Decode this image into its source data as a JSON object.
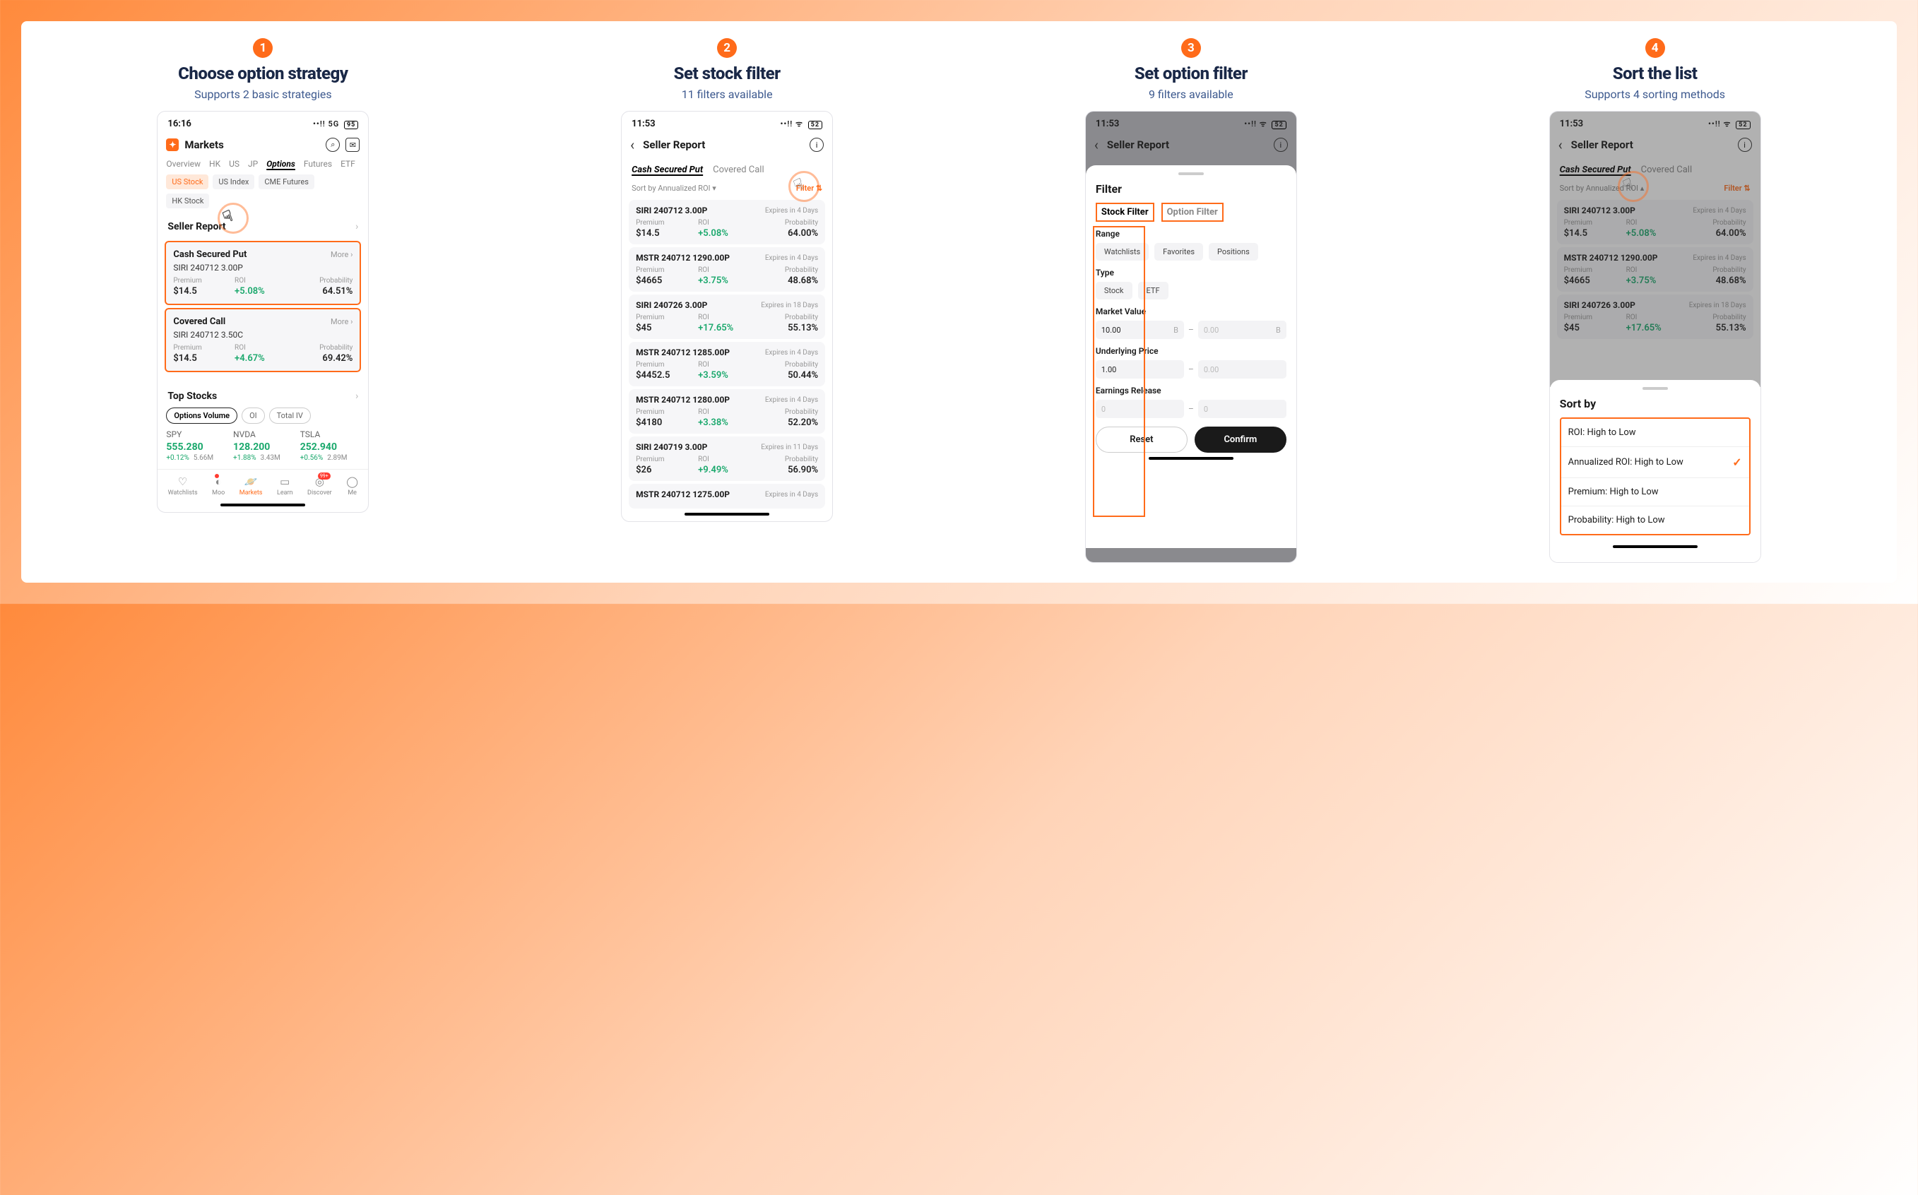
{
  "steps": [
    {
      "num": "1",
      "title": "Choose option strategy",
      "subtitle": "Supports 2 basic strategies"
    },
    {
      "num": "2",
      "title": "Set stock filter",
      "subtitle": "11 filters available"
    },
    {
      "num": "3",
      "title": "Set option filter",
      "subtitle": "9 filters available"
    },
    {
      "num": "4",
      "title": "Sort  the list",
      "subtitle": "Supports 4 sorting methods"
    }
  ],
  "p1": {
    "time": "16:16",
    "signal": "5G",
    "battery": "95",
    "brand": "Markets",
    "nav": [
      "Overview",
      "HK",
      "US",
      "JP",
      "Options",
      "Futures",
      "ETF"
    ],
    "navActive": "Options",
    "chips": [
      "US Stock",
      "US Index",
      "CME Futures",
      "HK Stock"
    ],
    "chipActive": "US Stock",
    "section": "Seller Report",
    "cards": [
      {
        "title": "Cash Secured Put",
        "more": "More ›",
        "sub": "SIRI 240712 3.00P",
        "premium": "$14.5",
        "roi": "+5.08%",
        "prob": "64.51%"
      },
      {
        "title": "Covered Call",
        "more": "More ›",
        "sub": "SIRI 240712 3.50C",
        "premium": "$14.5",
        "roi": "+4.67%",
        "prob": "69.42%"
      }
    ],
    "topStocks": "Top Stocks",
    "pills": [
      "Options Volume",
      "OI",
      "Total IV"
    ],
    "stocks": [
      {
        "sym": "SPY",
        "pr": "555.280",
        "pct": "+0.12%",
        "vol": "5.66M"
      },
      {
        "sym": "NVDA",
        "pr": "128.200",
        "pct": "+1.88%",
        "vol": "3.43M"
      },
      {
        "sym": "TSLA",
        "pr": "252.940",
        "pct": "+0.56%",
        "vol": "2.89M"
      }
    ],
    "bottomNav": [
      "Watchlists",
      "Moo",
      "Markets",
      "Learn",
      "Discover",
      "Me"
    ],
    "lbl": {
      "premium": "Premium",
      "roi": "ROI",
      "prob": "Probability"
    }
  },
  "p2": {
    "time": "11:53",
    "battery": "52",
    "header": "Seller Report",
    "stratTabs": [
      "Cash Secured Put",
      "Covered Call"
    ],
    "sortLabel": "Sort by Annualized ROI ▾",
    "filterLabel": "Filter ⇅",
    "items": [
      {
        "t": "SIRI 240712 3.00P",
        "exp": "Expires in 4 Days",
        "premium": "$14.5",
        "roi": "+5.08%",
        "prob": "64.00%"
      },
      {
        "t": "MSTR 240712 1290.00P",
        "exp": "Expires in 4 Days",
        "premium": "$4665",
        "roi": "+3.75%",
        "prob": "48.68%"
      },
      {
        "t": "SIRI 240726 3.00P",
        "exp": "Expires in 18 Days",
        "premium": "$45",
        "roi": "+17.65%",
        "prob": "55.13%"
      },
      {
        "t": "MSTR 240712 1285.00P",
        "exp": "Expires in 4 Days",
        "premium": "$4452.5",
        "roi": "+3.59%",
        "prob": "50.44%"
      },
      {
        "t": "MSTR 240712 1280.00P",
        "exp": "Expires in 4 Days",
        "premium": "$4180",
        "roi": "+3.38%",
        "prob": "52.20%"
      },
      {
        "t": "SIRI 240719 3.00P",
        "exp": "Expires in 11 Days",
        "premium": "$26",
        "roi": "+9.49%",
        "prob": "56.90%"
      },
      {
        "t": "MSTR 240712 1275.00P",
        "exp": "Expires in 4 Days"
      }
    ]
  },
  "p3": {
    "time": "11:53",
    "battery": "52",
    "header": "Seller Report",
    "filterTitle": "Filter",
    "filterTabs": [
      "Stock Filter",
      "Option Filter"
    ],
    "sections": {
      "range": {
        "label": "Range",
        "chips": [
          "Watchlists",
          "Favorites",
          "Positions"
        ]
      },
      "type": {
        "label": "Type",
        "chips": [
          "Stock",
          "ETF"
        ]
      },
      "mv": {
        "label": "Market Value",
        "from": "10.00",
        "unit": "B",
        "to": "0.00"
      },
      "up": {
        "label": "Underlying Price",
        "from": "1.00",
        "to": "0.00"
      },
      "er": {
        "label": "Earnings Release",
        "from": "0",
        "to": "0"
      }
    },
    "reset": "Reset",
    "confirm": "Confirm"
  },
  "p4": {
    "time": "11:53",
    "battery": "52",
    "header": "Seller Report",
    "stratTabs": [
      "Cash Secured Put",
      "Covered Call"
    ],
    "sortLabel": "Sort by Annualized ROI ▴",
    "filterLabel": "Filter ⇅",
    "items": [
      {
        "t": "SIRI 240712 3.00P",
        "exp": "Expires in 4 Days",
        "premium": "$14.5",
        "roi": "+5.08%",
        "prob": "64.00%"
      },
      {
        "t": "MSTR 240712 1290.00P",
        "exp": "Expires in 4 Days",
        "premium": "$4665",
        "roi": "+3.75%",
        "prob": "48.68%"
      },
      {
        "t": "SIRI 240726 3.00P",
        "exp": "Expires in 18 Days",
        "premium": "$45",
        "roi": "+17.65%",
        "prob": "55.13%"
      }
    ],
    "sortTitle": "Sort by",
    "sortOpts": [
      "ROI: High to Low",
      "Annualized ROI: High to Low",
      "Premium: High to Low",
      "Probability: High to Low"
    ],
    "sortSelected": 1
  }
}
